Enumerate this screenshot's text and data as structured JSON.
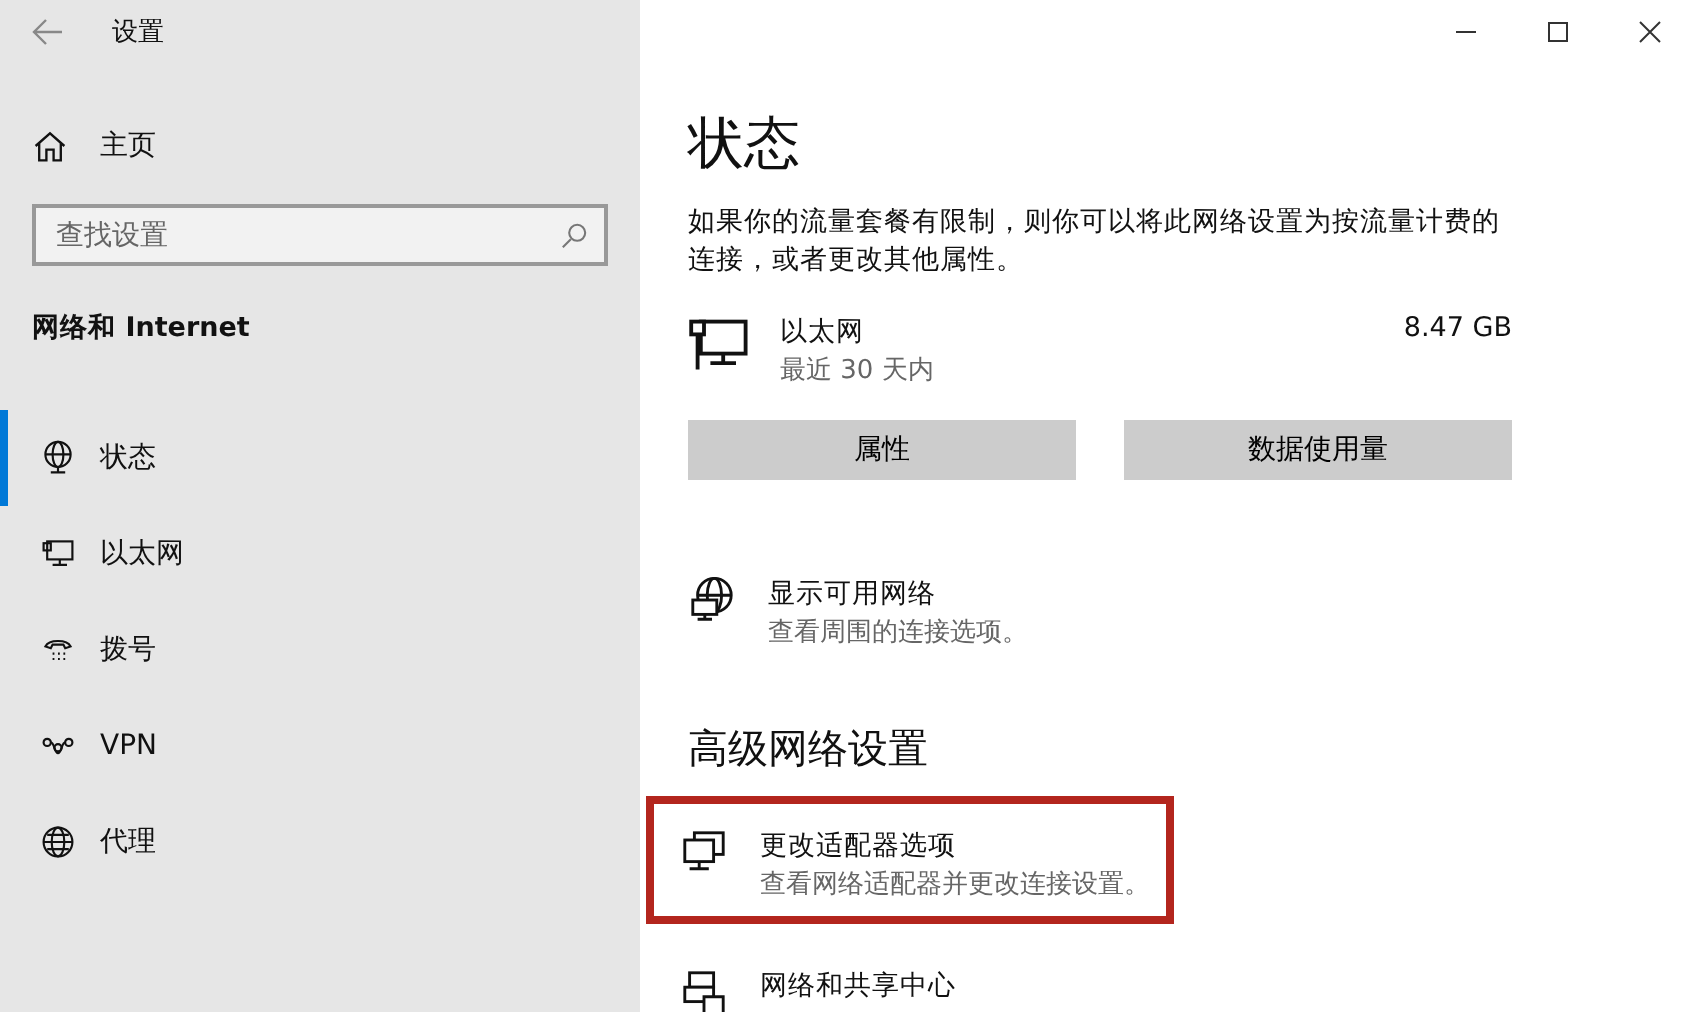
{
  "window": {
    "title": "设置"
  },
  "sidebar": {
    "home": "主页",
    "search": {
      "placeholder": "查找设置"
    },
    "section_title": "网络和 Internet",
    "items": [
      {
        "label": "状态",
        "kind": "status",
        "selected": true
      },
      {
        "label": "以太网",
        "kind": "ethernet",
        "selected": false
      },
      {
        "label": "拨号",
        "kind": "dialup",
        "selected": false
      },
      {
        "label": "VPN",
        "kind": "vpn",
        "selected": false
      },
      {
        "label": "代理",
        "kind": "globe",
        "selected": false
      }
    ]
  },
  "content": {
    "title": "状态",
    "description": "如果你的流量套餐有限制，则你可以将此网络设置为按流量计费的连接，或者更改其他属性。",
    "connection": {
      "name": "以太网",
      "period": "最近 30 天内",
      "usage": "8.47 GB"
    },
    "buttons": [
      "属性",
      "数据使用量"
    ],
    "show_networks": {
      "title": "显示可用网络",
      "subtitle": "查看周围的连接选项。",
      "kind": "globe-pc"
    },
    "advanced_heading": "高级网络设置",
    "advanced_items": [
      {
        "title": "更改适配器选项",
        "subtitle": "查看网络适配器并更改连接设置。",
        "kind": "adapter",
        "highlighted": true
      },
      {
        "title": "网络和共享中心",
        "kind": "sharing",
        "highlighted": false
      }
    ]
  }
}
